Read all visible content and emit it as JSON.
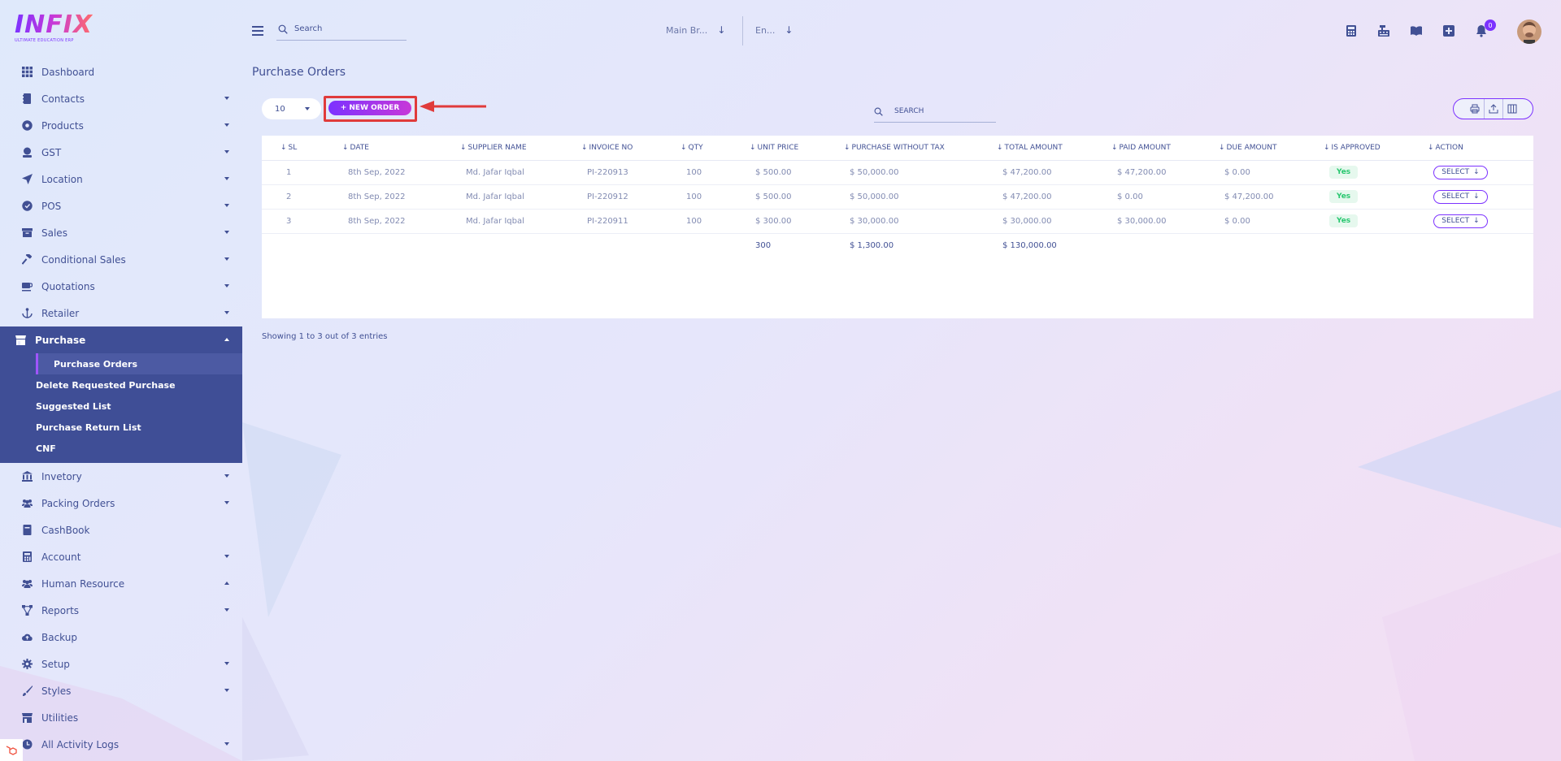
{
  "brand": {
    "logo_text": "INFIX",
    "logo_tagline": "ULTIMATE EDUCATION ERP",
    "accent": "#7c32ff",
    "sidebar_active_bg": "#3f4e96"
  },
  "header": {
    "search_placeholder": "Search",
    "branch_select": "Main Br...",
    "language_select": "En...",
    "notification_count": "0",
    "icons": [
      "calculator-icon",
      "cash-register-icon",
      "book-icon",
      "plus-square-icon",
      "bell-icon"
    ]
  },
  "sidebar": {
    "items": [
      {
        "label": "Dashboard",
        "icon": "grid-icon",
        "caret": false
      },
      {
        "label": "Contacts",
        "icon": "contact-book-icon",
        "caret": true
      },
      {
        "label": "Products",
        "icon": "product-icon",
        "caret": true
      },
      {
        "label": "GST",
        "icon": "money-icon",
        "caret": true
      },
      {
        "label": "Location",
        "icon": "location-arrow-icon",
        "caret": true
      },
      {
        "label": "POS",
        "icon": "pos-icon",
        "caret": true
      },
      {
        "label": "Sales",
        "icon": "box-icon",
        "caret": true
      },
      {
        "label": "Conditional Sales",
        "icon": "hammer-icon",
        "caret": true
      },
      {
        "label": "Quotations",
        "icon": "coffee-icon",
        "caret": true
      },
      {
        "label": "Retailer",
        "icon": "anchor-icon",
        "caret": true
      }
    ],
    "purchase": {
      "label": "Purchase",
      "icon": "store-icon",
      "children": [
        "Purchase Orders",
        "Delete Requested Purchase",
        "Suggested List",
        "Purchase Return List",
        "CNF"
      ]
    },
    "items_after": [
      {
        "label": "Invetory",
        "icon": "bank-icon",
        "caret": true,
        "caret_up": false
      },
      {
        "label": "Packing Orders",
        "icon": "users-icon",
        "caret": true,
        "caret_up": false
      },
      {
        "label": "CashBook",
        "icon": "book-icon",
        "caret": false,
        "caret_up": false
      },
      {
        "label": "Account",
        "icon": "calculator-icon",
        "caret": true,
        "caret_up": false
      },
      {
        "label": "Human Resource",
        "icon": "users-icon",
        "caret": true,
        "caret_up": true
      },
      {
        "label": "Reports",
        "icon": "project-diagram-icon",
        "caret": true,
        "caret_up": false
      },
      {
        "label": "Backup",
        "icon": "cloud-upload-icon",
        "caret": false,
        "caret_up": false
      },
      {
        "label": "Setup",
        "icon": "cog-icon",
        "caret": true,
        "caret_up": false
      },
      {
        "label": "Styles",
        "icon": "brush-icon",
        "caret": true,
        "caret_up": false
      },
      {
        "label": "Utilities",
        "icon": "store-icon",
        "caret": false,
        "caret_up": false
      },
      {
        "label": "All Activity Logs",
        "icon": "history-icon",
        "caret": true,
        "caret_up": false
      }
    ]
  },
  "main": {
    "title": "Purchase Orders",
    "page_size": "10",
    "new_order_label": "+ NEW ORDER",
    "table_search_placeholder": "SEARCH",
    "table": {
      "columns": [
        "SL",
        "DATE",
        "SUPPLIER NAME",
        "INVOICE NO",
        "QTY",
        "UNIT PRICE",
        "PURCHASE WITHOUT TAX",
        "TOTAL AMOUNT",
        "PAID AMOUNT",
        "DUE AMOUNT",
        "IS APPROVED",
        "ACTION"
      ],
      "rows": [
        [
          "1",
          "8th Sep, 2022",
          "Md. Jafar Iqbal",
          "PI-220913",
          "100",
          "$ 500.00",
          "$ 50,000.00",
          "$ 47,200.00",
          "$ 47,200.00",
          "$ 0.00",
          "Yes",
          "SELECT"
        ],
        [
          "2",
          "8th Sep, 2022",
          "Md. Jafar Iqbal",
          "PI-220912",
          "100",
          "$ 500.00",
          "$ 50,000.00",
          "$ 47,200.00",
          "$ 0.00",
          "$ 47,200.00",
          "Yes",
          "SELECT"
        ],
        [
          "3",
          "8th Sep, 2022",
          "Md. Jafar Iqbal",
          "PI-220911",
          "100",
          "$ 300.00",
          "$ 30,000.00",
          "$ 30,000.00",
          "$ 30,000.00",
          "$ 0.00",
          "Yes",
          "SELECT"
        ]
      ],
      "totals": {
        "unit_price": "300",
        "purchase_without_tax": "$ 1,300.00",
        "total_amount": "$ 130,000.00"
      }
    },
    "showing": "Showing 1 to 3 out of 3 entries"
  }
}
